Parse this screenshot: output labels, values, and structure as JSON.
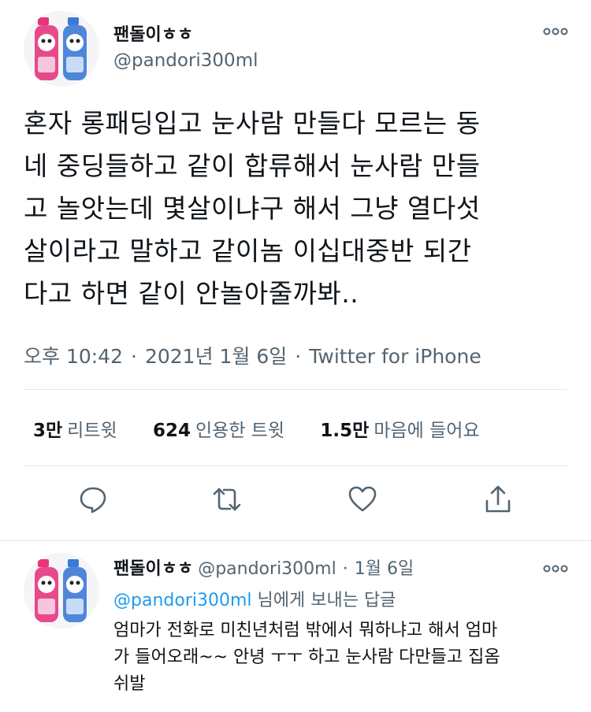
{
  "main_tweet": {
    "display_name": "팬돌이ㅎㅎ",
    "handle": "@pandori300ml",
    "text_lines": [
      "혼자 롱패딩입고 눈사람 만들다 모르는 동",
      "네 중딩들하고 같이 합류해서 눈사람 만들",
      "고 놀앗는데 몇살이냐구 해서 그냥 열다섯",
      "살이라고 말하고 같이놈 이십대중반 되간",
      "다고 하면 같이 안놀아줄까봐.."
    ],
    "time": "오후 10:42",
    "date": "2021년 1월 6일",
    "source": "Twitter for iPhone"
  },
  "stats": {
    "retweets_count": "3만",
    "retweets_label": "리트윗",
    "quotes_count": "624",
    "quotes_label": "인용한 트윗",
    "likes_count": "1.5만",
    "likes_label": "마음에 들어요"
  },
  "actions": {
    "reply_icon": "reply-icon",
    "retweet_icon": "retweet-icon",
    "like_icon": "heart-icon",
    "share_icon": "share-icon"
  },
  "reply_tweet": {
    "display_name": "팬돌이ㅎㅎ",
    "handle": "@pandori300ml",
    "date": "1월 6일",
    "replying_to": "@pandori300ml",
    "replying_suffix": "님에게 보내는 답글",
    "text_lines": [
      "엄마가 전화로 미친년처럼 밖에서 뭐하냐고 해서 엄마",
      "가 들어오래~~ 안녕 ㅜㅜ 하고 눈사람 다만들고 집옴",
      "쉬발"
    ]
  },
  "colors": {
    "text": "#0f1419",
    "secondary": "#536471",
    "accent": "#1d9bf0",
    "divider": "#e1e8ed"
  }
}
